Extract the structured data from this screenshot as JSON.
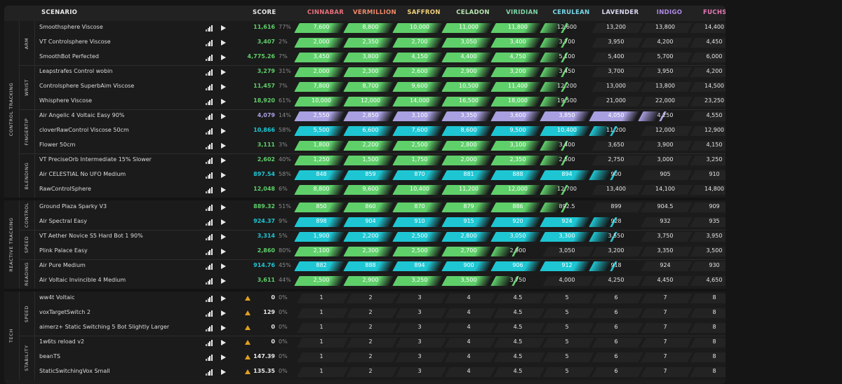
{
  "columns": {
    "scenario": "SCENARIO",
    "score": "SCORE",
    "ranks": [
      {
        "name": "CINNABAR",
        "color": "#e8707a"
      },
      {
        "name": "VERMILLION",
        "color": "#f08a6a"
      },
      {
        "name": "SAFFRON",
        "color": "#f2d27a"
      },
      {
        "name": "CELADON",
        "color": "#b8e6b0"
      },
      {
        "name": "VIRIDIAN",
        "color": "#7fd6a8"
      },
      {
        "name": "CERULEAN",
        "color": "#7ad8e8"
      },
      {
        "name": "LAVENDER",
        "color": "#d8d8f0"
      },
      {
        "name": "INDIGO",
        "color": "#b08ae8"
      },
      {
        "name": "FUCHSIA",
        "color": "#e87ab8"
      }
    ]
  },
  "colors": {
    "green": "#5fcf6a",
    "cyan": "#1ec6d3",
    "lavender": "#a8a0e0",
    "warn": "#e0a020"
  },
  "sections": [
    {
      "label": "CONTROL TRACKING",
      "groups": [
        {
          "label": "ARM",
          "rows": [
            {
              "name": "Smoothsphere Viscose",
              "score": "11,616",
              "pct": "77%",
              "fill": 5,
              "color": "green",
              "partial": true,
              "thresholds": [
                "7,600",
                "8,800",
                "10,000",
                "11,000",
                "11,800",
                "12,600",
                "13,200",
                "13,800",
                "14,400"
              ]
            },
            {
              "name": "VT Controlsphere Viscose",
              "score": "3,407",
              "pct": "2%",
              "fill": 5,
              "color": "green",
              "partial": true,
              "thresholds": [
                "2,000",
                "2,350",
                "2,700",
                "3,050",
                "3,400",
                "3,700",
                "3,950",
                "4,200",
                "4,450"
              ]
            },
            {
              "name": "SmoothBot Perfected",
              "score": "4,775.26",
              "pct": "7%",
              "fill": 5,
              "color": "green",
              "partial": true,
              "thresholds": [
                "3,450",
                "3,800",
                "4,150",
                "4,400",
                "4,750",
                "5,100",
                "5,400",
                "5,700",
                "6,000"
              ]
            }
          ]
        },
        {
          "label": "WRIST",
          "rows": [
            {
              "name": "Leapstrafes Control wobin",
              "score": "3,279",
              "pct": "31%",
              "fill": 5,
              "color": "green",
              "partial": true,
              "thresholds": [
                "2,000",
                "2,300",
                "2,600",
                "2,900",
                "3,200",
                "3,450",
                "3,700",
                "3,950",
                "4,200"
              ]
            },
            {
              "name": "Controlsphere SuperbAim Viscose",
              "score": "11,457",
              "pct": "7%",
              "fill": 5,
              "color": "green",
              "partial": true,
              "thresholds": [
                "7,800",
                "8,700",
                "9,600",
                "10,500",
                "11,400",
                "12,200",
                "13,000",
                "13,800",
                "14,500"
              ]
            },
            {
              "name": "Whisphere Viscose",
              "score": "18,920",
              "pct": "61%",
              "fill": 5,
              "color": "green",
              "partial": true,
              "thresholds": [
                "10,000",
                "12,000",
                "14,000",
                "16,500",
                "18,000",
                "19,500",
                "21,000",
                "22,000",
                "23,250"
              ]
            }
          ]
        },
        {
          "label": "FINGERTIP",
          "rows": [
            {
              "name": "Air Angelic 4 Voltaic Easy 90%",
              "score": "4,079",
              "pct": "14%",
              "fill": 7,
              "color": "lavender",
              "partial": true,
              "thresholds": [
                "2,550",
                "2,850",
                "3,100",
                "3,350",
                "3,600",
                "3,850",
                "4,050",
                "4,250",
                "4,550"
              ]
            },
            {
              "name": "cloverRawControl Viscose 50cm",
              "score": "10,866",
              "pct": "58%",
              "fill": 6,
              "color": "cyan",
              "partial": true,
              "thresholds": [
                "5,500",
                "6,600",
                "7,600",
                "8,600",
                "9,500",
                "10,400",
                "11,200",
                "12,000",
                "12,900"
              ]
            },
            {
              "name": "Flower 50cm",
              "score": "3,111",
              "pct": "3%",
              "fill": 5,
              "color": "green",
              "partial": true,
              "thresholds": [
                "1,800",
                "2,200",
                "2,500",
                "2,800",
                "3,100",
                "3,400",
                "3,650",
                "3,900",
                "4,150"
              ]
            }
          ]
        },
        {
          "label": "BLENDING",
          "rows": [
            {
              "name": "VT PreciseOrb Intermediate 15% Slower",
              "score": "2,602",
              "pct": "40%",
              "fill": 5,
              "color": "green",
              "partial": true,
              "thresholds": [
                "1,250",
                "1,500",
                "1,750",
                "2,000",
                "2,350",
                "2,500",
                "2,750",
                "3,000",
                "3,250"
              ]
            },
            {
              "name": "Air CELESTIAL No UFO Medium",
              "score": "897.54",
              "pct": "58%",
              "fill": 6,
              "color": "cyan",
              "partial": true,
              "thresholds": [
                "848",
                "859",
                "870",
                "881",
                "888",
                "894",
                "900",
                "905",
                "910"
              ]
            },
            {
              "name": "RawControlSphere",
              "score": "12,048",
              "pct": "6%",
              "fill": 5,
              "color": "green",
              "partial": true,
              "thresholds": [
                "8,800",
                "9,600",
                "10,400",
                "11,200",
                "12,000",
                "12,700",
                "13,400",
                "14,100",
                "14,800"
              ]
            }
          ]
        }
      ]
    },
    {
      "label": "REACTIVE TRACKING",
      "groups": [
        {
          "label": "CONTROL",
          "rows": [
            {
              "name": "Ground Plaza Sparky V3",
              "score": "889.32",
              "pct": "51%",
              "fill": 5,
              "color": "green",
              "partial": true,
              "thresholds": [
                "850",
                "860",
                "870",
                "879",
                "886",
                "892.5",
                "899",
                "904.5",
                "909"
              ]
            },
            {
              "name": "Air Spectral Easy",
              "score": "924.37",
              "pct": "9%",
              "fill": 6,
              "color": "cyan",
              "partial": true,
              "thresholds": [
                "898",
                "904",
                "910",
                "915",
                "920",
                "924",
                "928",
                "932",
                "935"
              ]
            }
          ]
        },
        {
          "label": "SPEED",
          "rows": [
            {
              "name": "VT Aether Novice S5 Hard Bot 1 90%",
              "score": "3,314",
              "pct": "5%",
              "fill": 6,
              "color": "cyan",
              "partial": true,
              "thresholds": [
                "1,900",
                "2,200",
                "2,500",
                "2,800",
                "3,050",
                "3,300",
                "3,550",
                "3,750",
                "3,950"
              ]
            },
            {
              "name": "Plink Palace Easy",
              "score": "2,860",
              "pct": "80%",
              "fill": 4,
              "color": "green",
              "partial": true,
              "thresholds": [
                "2,100",
                "2,300",
                "2,500",
                "2,700",
                "2,900",
                "3,050",
                "3,200",
                "3,350",
                "3,500"
              ]
            }
          ]
        },
        {
          "label": "READING",
          "rows": [
            {
              "name": "Air Pure Medium",
              "score": "914.76",
              "pct": "45%",
              "fill": 6,
              "color": "cyan",
              "partial": true,
              "thresholds": [
                "882",
                "888",
                "894",
                "900",
                "906",
                "912",
                "918",
                "924",
                "930"
              ]
            },
            {
              "name": "Air Voltaic Invincible 4 Medium",
              "score": "3,611",
              "pct": "44%",
              "fill": 4,
              "color": "green",
              "partial": true,
              "thresholds": [
                "2,500",
                "2,900",
                "3,250",
                "3,500",
                "3,750",
                "4,000",
                "4,250",
                "4,450",
                "4,650"
              ]
            }
          ]
        }
      ]
    },
    {
      "label": "TECH",
      "groups": [
        {
          "label": "SPEED",
          "rows": [
            {
              "name": "ww4t Voltaic",
              "score": "0",
              "pct": "0%",
              "fill": 0,
              "warn": true,
              "thresholds": [
                "1",
                "2",
                "3",
                "4",
                "4.5",
                "5",
                "6",
                "7",
                "8"
              ]
            },
            {
              "name": "voxTargetSwitch 2",
              "score": "129",
              "pct": "0%",
              "fill": 0,
              "warn": true,
              "thresholds": [
                "1",
                "2",
                "3",
                "4",
                "4.5",
                "5",
                "6",
                "7",
                "8"
              ]
            },
            {
              "name": "aimerz+ Static Switching 5 Bot Slightly Larger",
              "score": "0",
              "pct": "0%",
              "fill": 0,
              "warn": true,
              "thresholds": [
                "1",
                "2",
                "3",
                "4",
                "4.5",
                "5",
                "6",
                "7",
                "8"
              ]
            }
          ]
        },
        {
          "label": "STABILITY",
          "rows": [
            {
              "name": "1w6ts reload v2",
              "score": "0",
              "pct": "0%",
              "fill": 0,
              "warn": true,
              "thresholds": [
                "1",
                "2",
                "3",
                "4",
                "4.5",
                "5",
                "6",
                "7",
                "8"
              ]
            },
            {
              "name": "beanTS",
              "score": "147.39",
              "pct": "0%",
              "fill": 0,
              "warn": true,
              "thresholds": [
                "1",
                "2",
                "3",
                "4",
                "4.5",
                "5",
                "6",
                "7",
                "8"
              ]
            },
            {
              "name": "StaticSwitchingVox Small",
              "score": "135.35",
              "pct": "0%",
              "fill": 0,
              "warn": true,
              "thresholds": [
                "1",
                "2",
                "3",
                "4",
                "4.5",
                "5",
                "6",
                "7",
                "8"
              ]
            }
          ]
        }
      ]
    }
  ]
}
